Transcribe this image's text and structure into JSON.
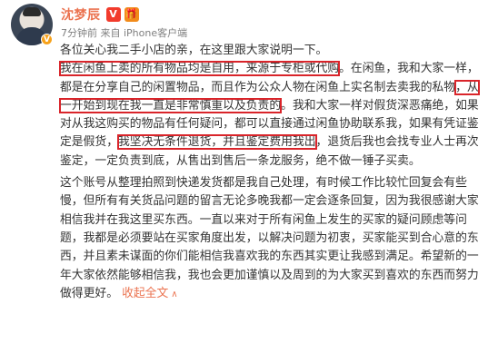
{
  "author": {
    "name": "沈梦辰",
    "verified_badge": "V",
    "icon_badge": "🎁",
    "avatar_badge": "V"
  },
  "meta": "7分钟前 来自 iPhone客户端",
  "post": {
    "p1": {
      "s1": "各位关心我二手小店的亲，在这里跟大家说明一下。",
      "hl1": "我在闲鱼上卖的所有物品均是自用，来源于专柜或代购",
      "s2": "。在闲鱼，我和大家一样，都是在分享自己的闲置物品，而且作为公众人物在闲鱼上实名制去卖我的私物",
      "hl2": "，从一开始到现在我一直是非常慎重以及负责的",
      "s3": "。我和大家一样对假货深恶痛绝，如果对从我这购买的物品有任何疑问，都可以直接通过闲鱼协助联系我，如果有凭证鉴定是假货，",
      "hl3": "我坚决无条件退货，并且鉴定费用我出",
      "s4": "，退货后我也会找专业人士再次鉴定，一定负责到底，从售出到售后一条龙服务，绝不做一锤子买卖。"
    },
    "p2": {
      "text": "这个账号从整理拍照到快递发货都是我自己处理，有时候工作比较忙回复会有些慢，但所有有关货品问题的留言无论多晚我都一定会逐条回复，因为我很感谢大家相信我并在我这里买东西。一直以来对于所有闲鱼上发生的买家的疑问顾虑等问题，我都是必须要站在买家角度出发，以解决问题为初衷，买家能买到合心意的东西，并且素未谋面的你们能相信我喜欢我的东西其实更让我感到满足。希望新的一年大家依然能够相信我，我也会更加谨慎以及周到的为大家买到喜欢的东西而努力做得更好。",
      "collapse_label": "收起全文",
      "collapse_icon": "∧"
    }
  }
}
